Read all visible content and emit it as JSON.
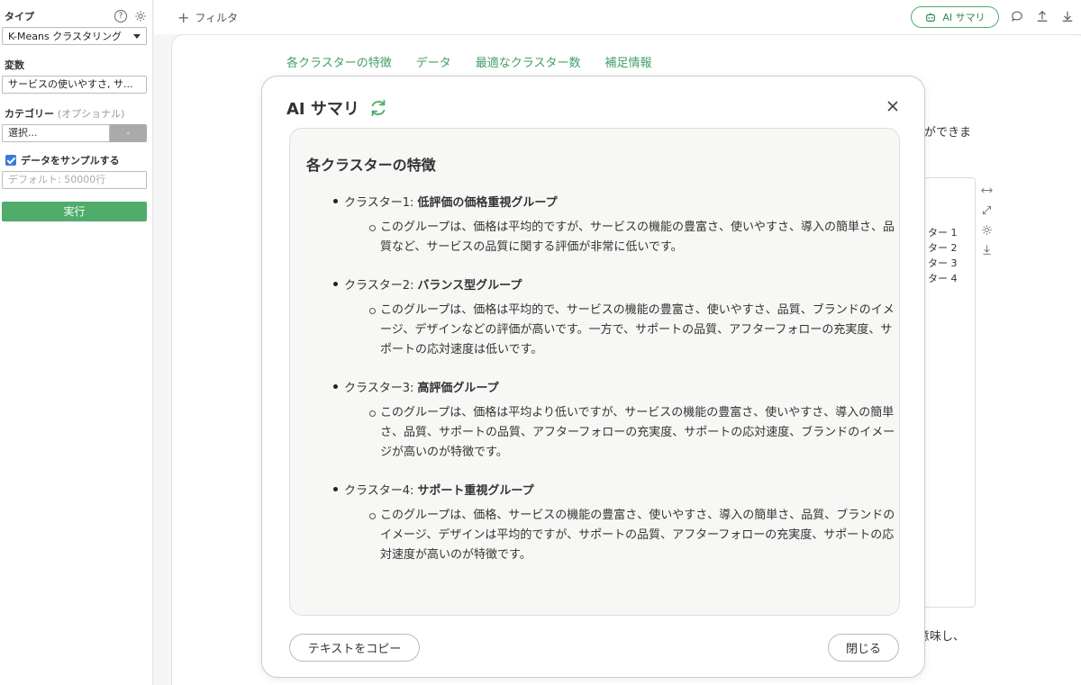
{
  "sidebar": {
    "type_label": "タイプ",
    "type_value": "K-Means クラスタリング",
    "variable_label": "変数",
    "variable_value": "サービスの使いやすさ, サ...",
    "category_label": "カテゴリー",
    "category_optional": "(オプショナル)",
    "category_placeholder": "選択...",
    "category_dash": "-",
    "sample_label": "データをサンプルする",
    "sample_placeholder": "デフォルト: 50000行",
    "run_label": "実行"
  },
  "topbar": {
    "filter_label": "フィルタ",
    "ai_summary_label": "AI サマリ"
  },
  "tabs": [
    "各クラスターの特徴",
    "データ",
    "最適なクラスター数",
    "補足情報"
  ],
  "background": {
    "text_right_1": "ができま",
    "text_right_2": "意味し、",
    "legend": [
      "ター 1",
      "ター 2",
      "ター 3",
      "ター 4"
    ]
  },
  "modal": {
    "title": "AI サマリ",
    "section_title": "各クラスターの特徴",
    "clusters": [
      {
        "name": "クラスター1:",
        "title": "低評価の価格重視グループ",
        "desc": "このグループは、価格は平均的ですが、サービスの機能の豊富さ、使いやすさ、導入の簡単さ、品質など、サービスの品質に関する評価が非常に低いです。"
      },
      {
        "name": "クラスター2:",
        "title": "バランス型グループ",
        "desc": "このグループは、価格は平均的で、サービスの機能の豊富さ、使いやすさ、品質、ブランドのイメージ、デザインなどの評価が高いです。一方で、サポートの品質、アフターフォローの充実度、サポートの応対速度は低いです。"
      },
      {
        "name": "クラスター3:",
        "title": "高評価グループ",
        "desc": "このグループは、価格は平均より低いですが、サービスの機能の豊富さ、使いやすさ、導入の簡単さ、品質、サポートの品質、アフターフォローの充実度、サポートの応対速度、ブランドのイメージが高いのが特徴です。"
      },
      {
        "name": "クラスター4:",
        "title": "サポート重視グループ",
        "desc": "このグループは、価格、サービスの機能の豊富さ、使いやすさ、導入の簡単さ、品質、ブランドのイメージ、デザインは平均的ですが、サポートの品質、アフターフォローの充実度、サポートの応対速度が高いのが特徴です。"
      }
    ],
    "copy_button": "テキストをコピー",
    "close_button": "閉じる"
  },
  "colors": {
    "accent_green": "#4fac6b",
    "tab_green": "#3fa163",
    "checkbox_blue": "#3a7bd5"
  }
}
